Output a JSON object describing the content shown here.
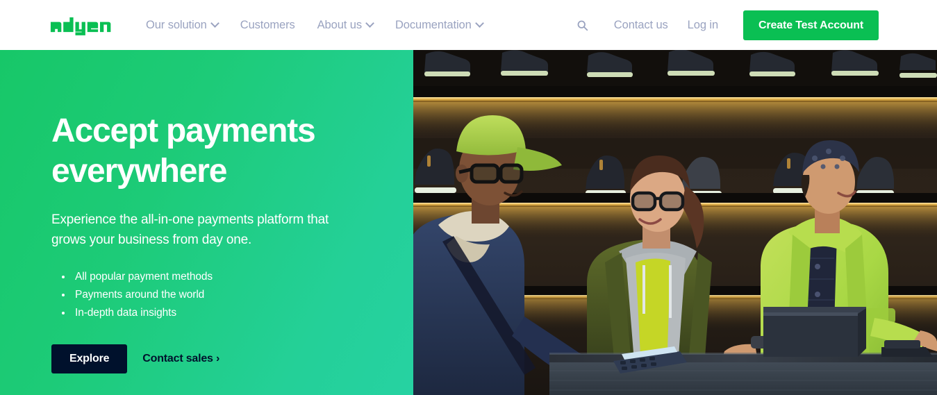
{
  "brand": {
    "logo_text": "adyen",
    "logo_color": "#0abf53"
  },
  "header": {
    "nav": [
      {
        "label": "Our solution",
        "has_dropdown": true
      },
      {
        "label": "Customers",
        "has_dropdown": false
      },
      {
        "label": "About us",
        "has_dropdown": true
      },
      {
        "label": "Documentation",
        "has_dropdown": true
      }
    ],
    "search_icon": "search-icon",
    "contact_label": "Contact us",
    "login_label": "Log in",
    "cta_label": "Create Test Account",
    "cta_color": "#0abf53",
    "nav_text_color": "#9aa3c0",
    "background": "#ffffff"
  },
  "hero": {
    "title": "Accept payments everywhere",
    "subtitle": "Experience the all-in-one payments platform that grows your business from day one.",
    "bullets": [
      "All popular payment methods",
      "Payments around the world",
      "In-depth data insights"
    ],
    "primary_button": "Explore",
    "secondary_link": "Contact sales ›",
    "gradient_start": "#17c768",
    "gradient_end": "#26d2a2",
    "primary_button_color": "#00112c",
    "text_color": "#ffffff",
    "image_alt": "Three people at a sneaker store checkout counter, customer tapping a card on a payment terminal"
  }
}
